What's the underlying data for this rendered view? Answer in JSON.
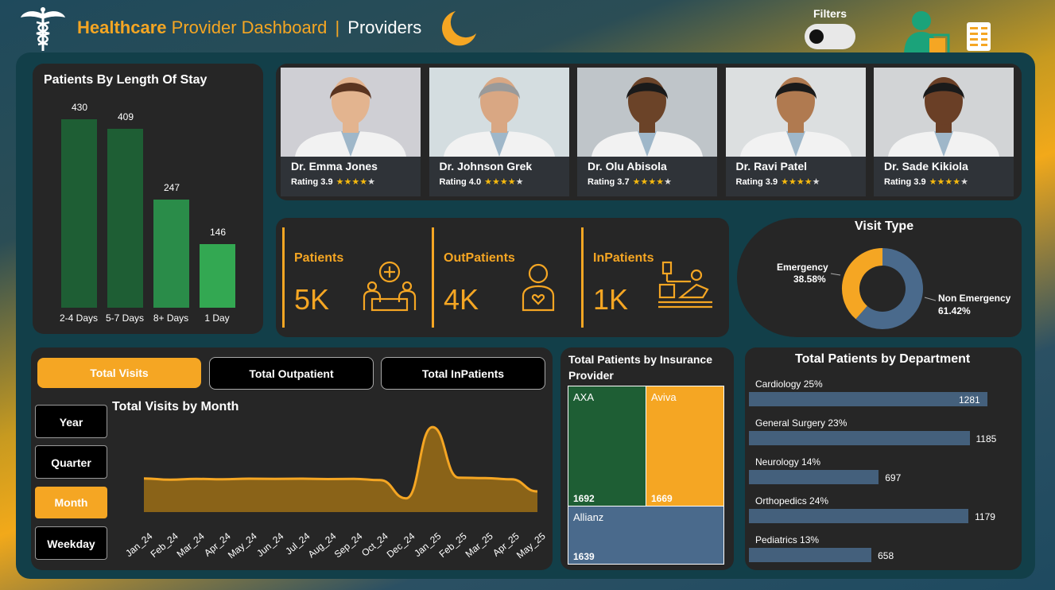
{
  "header": {
    "title_part1": "Healthcare",
    "title_part2": "Provider Dashboard",
    "separator": "|",
    "title_part3": "Providers",
    "filters_label": "Filters"
  },
  "colors": {
    "accent": "#f5a623",
    "dark_green": "#1e5e34",
    "mid_green": "#2a8c49",
    "light_green": "#33a852",
    "slate_blue": "#4a6a8c",
    "panel": "#262626"
  },
  "length_of_stay": {
    "title": "Patients By Length Of Stay",
    "chart_data": {
      "type": "bar",
      "categories": [
        "2-4 Days",
        "5-7 Days",
        "8+ Days",
        "1 Day"
      ],
      "values": [
        430,
        409,
        247,
        146
      ],
      "title": "Patients By Length Of Stay",
      "ylim": [
        0,
        430
      ]
    }
  },
  "doctors": [
    {
      "name": "Dr. Emma Jones",
      "rating_label": "Rating 3.9",
      "rating": 3.9
    },
    {
      "name": "Dr. Johnson Grek",
      "rating_label": "Rating 4.0",
      "rating": 4.0
    },
    {
      "name": "Dr. Olu Abisola",
      "rating_label": "Rating 3.7",
      "rating": 3.7
    },
    {
      "name": "Dr. Ravi Patel",
      "rating_label": "Rating 3.9",
      "rating": 3.9
    },
    {
      "name": "Dr. Sade Kikiola",
      "rating_label": "Rating 3.9",
      "rating": 3.9
    }
  ],
  "kpis": [
    {
      "label": "Patients",
      "value": "5K",
      "icon": "patient-care-icon"
    },
    {
      "label": "OutPatients",
      "value": "4K",
      "icon": "outpatient-person-icon"
    },
    {
      "label": "InPatients",
      "value": "1K",
      "icon": "inpatient-bed-icon"
    }
  ],
  "visit_type": {
    "title": "Visit Type",
    "emergency_label": "Emergency",
    "emergency_pct": "38.58%",
    "non_emergency_label": "Non Emergency",
    "non_emergency_pct": "61.42%",
    "chart_data": {
      "type": "pie",
      "categories": [
        "Emergency",
        "Non Emergency"
      ],
      "values": [
        38.58,
        61.42
      ],
      "title": "Visit Type"
    }
  },
  "trend": {
    "tabs": [
      "Total Visits",
      "Total Outpatient",
      "Total InPatients"
    ],
    "active_tab": "Total Visits",
    "granularity": [
      "Year",
      "Quarter",
      "Month",
      "Weekday"
    ],
    "active_granularity": "Month",
    "title": "Total Visits by Month",
    "chart_data": {
      "type": "area",
      "categories": [
        "Jan_24",
        "Feb_24",
        "Mar_24",
        "Apr_24",
        "May_24",
        "Jun_24",
        "Jul_24",
        "Aug_24",
        "Sep_24",
        "Oct_24",
        "Dec_24",
        "Jan_25",
        "Feb_25",
        "Mar_25",
        "Apr_25",
        "May_25"
      ],
      "values": [
        415,
        400,
        410,
        405,
        412,
        410,
        412,
        408,
        410,
        395,
        170,
        1050,
        425,
        420,
        405,
        255
      ],
      "title": "Total Visits by Month"
    }
  },
  "insurance": {
    "title": "Total Patients by Insurance Provider",
    "chart_data": {
      "type": "treemap",
      "categories": [
        "AXA",
        "Aviva",
        "Allianz"
      ],
      "values": [
        1692,
        1669,
        1639
      ]
    },
    "tiles": [
      {
        "name": "AXA",
        "value": "1692"
      },
      {
        "name": "Aviva",
        "value": "1669"
      },
      {
        "name": "Allianz",
        "value": "1639"
      }
    ]
  },
  "department": {
    "title": "Total Patients by Department",
    "chart_data": {
      "type": "bar",
      "categories": [
        "Cardiology 25%",
        "General Surgery 23%",
        "Neurology 14%",
        "Orthopedics 24%",
        "Pediatrics 13%"
      ],
      "values": [
        1281,
        1185,
        697,
        1179,
        658
      ],
      "title": "Total Patients by Department"
    }
  }
}
